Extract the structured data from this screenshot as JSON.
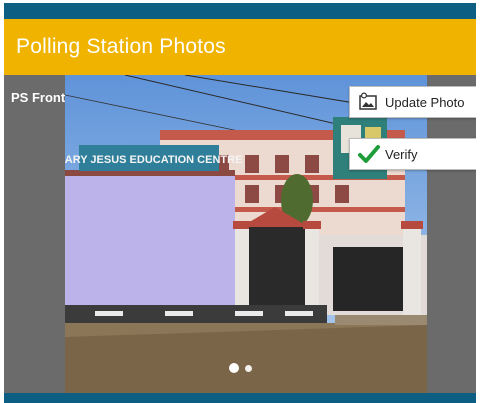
{
  "header": {
    "title": "Polling Station Photos"
  },
  "photo_panel": {
    "label": "PS Front View",
    "sign_text": "MARY JESUS EDUCATION CENTRE",
    "carousel": {
      "total": 2,
      "active_index": 0
    }
  },
  "actions": {
    "update_label": "Update Photo",
    "verify_label": "Verify"
  },
  "colors": {
    "header": "#f0b400",
    "strip": "#0c5f83",
    "panel": "#6b6b6b",
    "verify_check": "#1f9d3a"
  },
  "icons": {
    "update": "photo-edit-icon",
    "verify": "check-icon"
  }
}
